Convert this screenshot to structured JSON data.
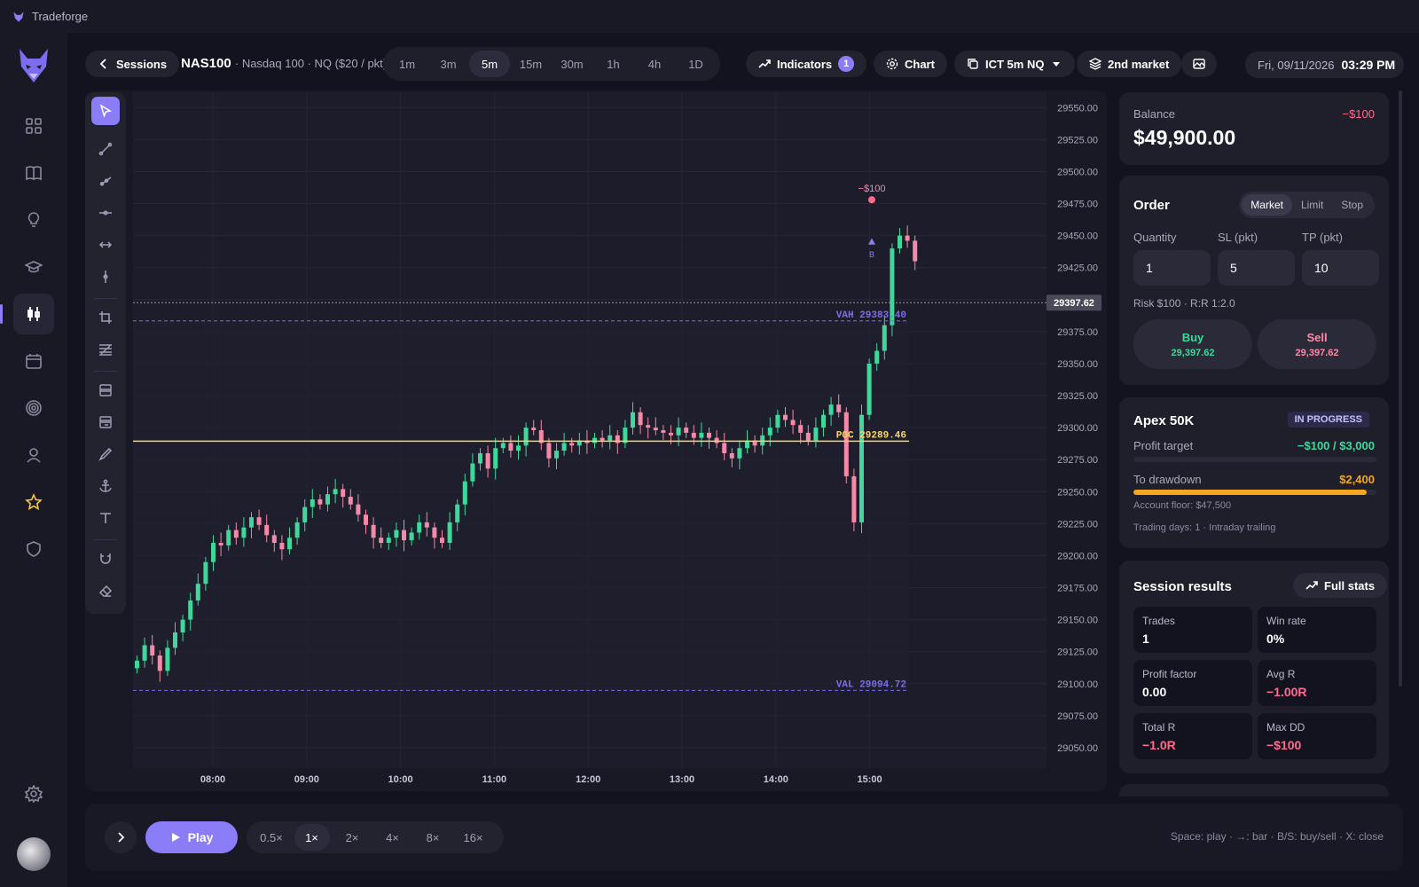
{
  "app": {
    "title": "Tradeforge"
  },
  "toolbar": {
    "sessions_label": "Sessions",
    "symbol": "NAS100",
    "symbol_desc": "· Nasdaq 100 · NQ ($20 / pkt)",
    "timeframes": [
      "1m",
      "3m",
      "5m",
      "15m",
      "30m",
      "1h",
      "4h",
      "1D"
    ],
    "active_timeframe": "5m",
    "indicators_label": "Indicators",
    "indicators_count": "1",
    "chart_label": "Chart",
    "template_label": "ICT 5m NQ",
    "market_label": "2nd market",
    "date": "Fri, 09/11/2026",
    "time": "03:29 PM"
  },
  "chart_data": {
    "type": "candlestick",
    "x_ticks": [
      "08:00",
      "09:00",
      "10:00",
      "11:00",
      "12:00",
      "13:00",
      "14:00",
      "15:00"
    ],
    "y_ticks": [
      "29550.00",
      "29525.00",
      "29500.00",
      "29475.00",
      "29450.00",
      "29425.00",
      "29400.00",
      "29375.00",
      "29350.00",
      "29325.00",
      "29300.00",
      "29275.00",
      "29250.00",
      "29225.00",
      "29200.00",
      "29175.00",
      "29150.00",
      "29125.00",
      "29100.00",
      "29075.00",
      "29050.00"
    ],
    "ylim": [
      29034,
      29562
    ],
    "last_price": "29397.62",
    "levels": [
      {
        "label": "VAH 29383.40",
        "value": 29383.4,
        "style": "dashed",
        "color": "#7a6cf0"
      },
      {
        "label": "POC 29289.46",
        "value": 29289.46,
        "style": "solid",
        "color": "#f5d56a"
      },
      {
        "label": "VAL 29094.72",
        "value": 29094.72,
        "style": "dashed",
        "color": "#7a6cf0"
      }
    ],
    "trade_marker": {
      "label": "−$100",
      "side": "B"
    },
    "up_color": "#3fd89a",
    "down_color": "#f48aa8"
  },
  "account": {
    "balance_label": "Balance",
    "balance": "$49,900.00",
    "balance_change": "−$100"
  },
  "order": {
    "title": "Order",
    "types": [
      "Market",
      "Limit",
      "Stop"
    ],
    "active_type": "Market",
    "quantity_label": "Quantity",
    "quantity": "1",
    "sl_label": "SL (pkt)",
    "sl": "5",
    "tp_label": "TP (pkt)",
    "tp": "10",
    "risk_text": "Risk $100 · R:R 1:2.0",
    "buy_label": "Buy",
    "buy_price": "29,397.62",
    "sell_label": "Sell",
    "sell_price": "29,397.62"
  },
  "challenge": {
    "name": "Apex 50K",
    "status": "IN PROGRESS",
    "profit_target_label": "Profit target",
    "profit_target_value": "−$100 / $3,000",
    "profit_progress": 0.0,
    "drawdown_label": "To drawdown",
    "drawdown_value": "$2,400",
    "drawdown_progress": 0.96,
    "floor": "Account floor: $47,500",
    "meta": "Trading days: 1 · Intraday trailing"
  },
  "session": {
    "title": "Session results",
    "full_stats_label": "Full stats",
    "stats": [
      {
        "label": "Trades",
        "value": "1",
        "color": "#ffffff"
      },
      {
        "label": "Win rate",
        "value": "0%",
        "color": "#ffffff"
      },
      {
        "label": "Profit factor",
        "value": "0.00",
        "color": "#ffffff"
      },
      {
        "label": "Avg R",
        "value": "−1.00R",
        "color": "#ff6b8b"
      },
      {
        "label": "Total R",
        "value": "−1.0R",
        "color": "#ff6b8b"
      },
      {
        "label": "Max DD",
        "value": "−$100",
        "color": "#ff6b8b"
      }
    ]
  },
  "playback": {
    "play_label": "Play",
    "speeds": [
      "0.5×",
      "1×",
      "2×",
      "4×",
      "8×",
      "16×"
    ],
    "active_speed": "1×",
    "hint": "Space: play · →: bar · B/S: buy/sell · X: close"
  },
  "colors": {
    "accent": "#8b7cf8",
    "up": "#3fd89a",
    "down": "#ff6b8b",
    "warning": "#f5a623"
  }
}
